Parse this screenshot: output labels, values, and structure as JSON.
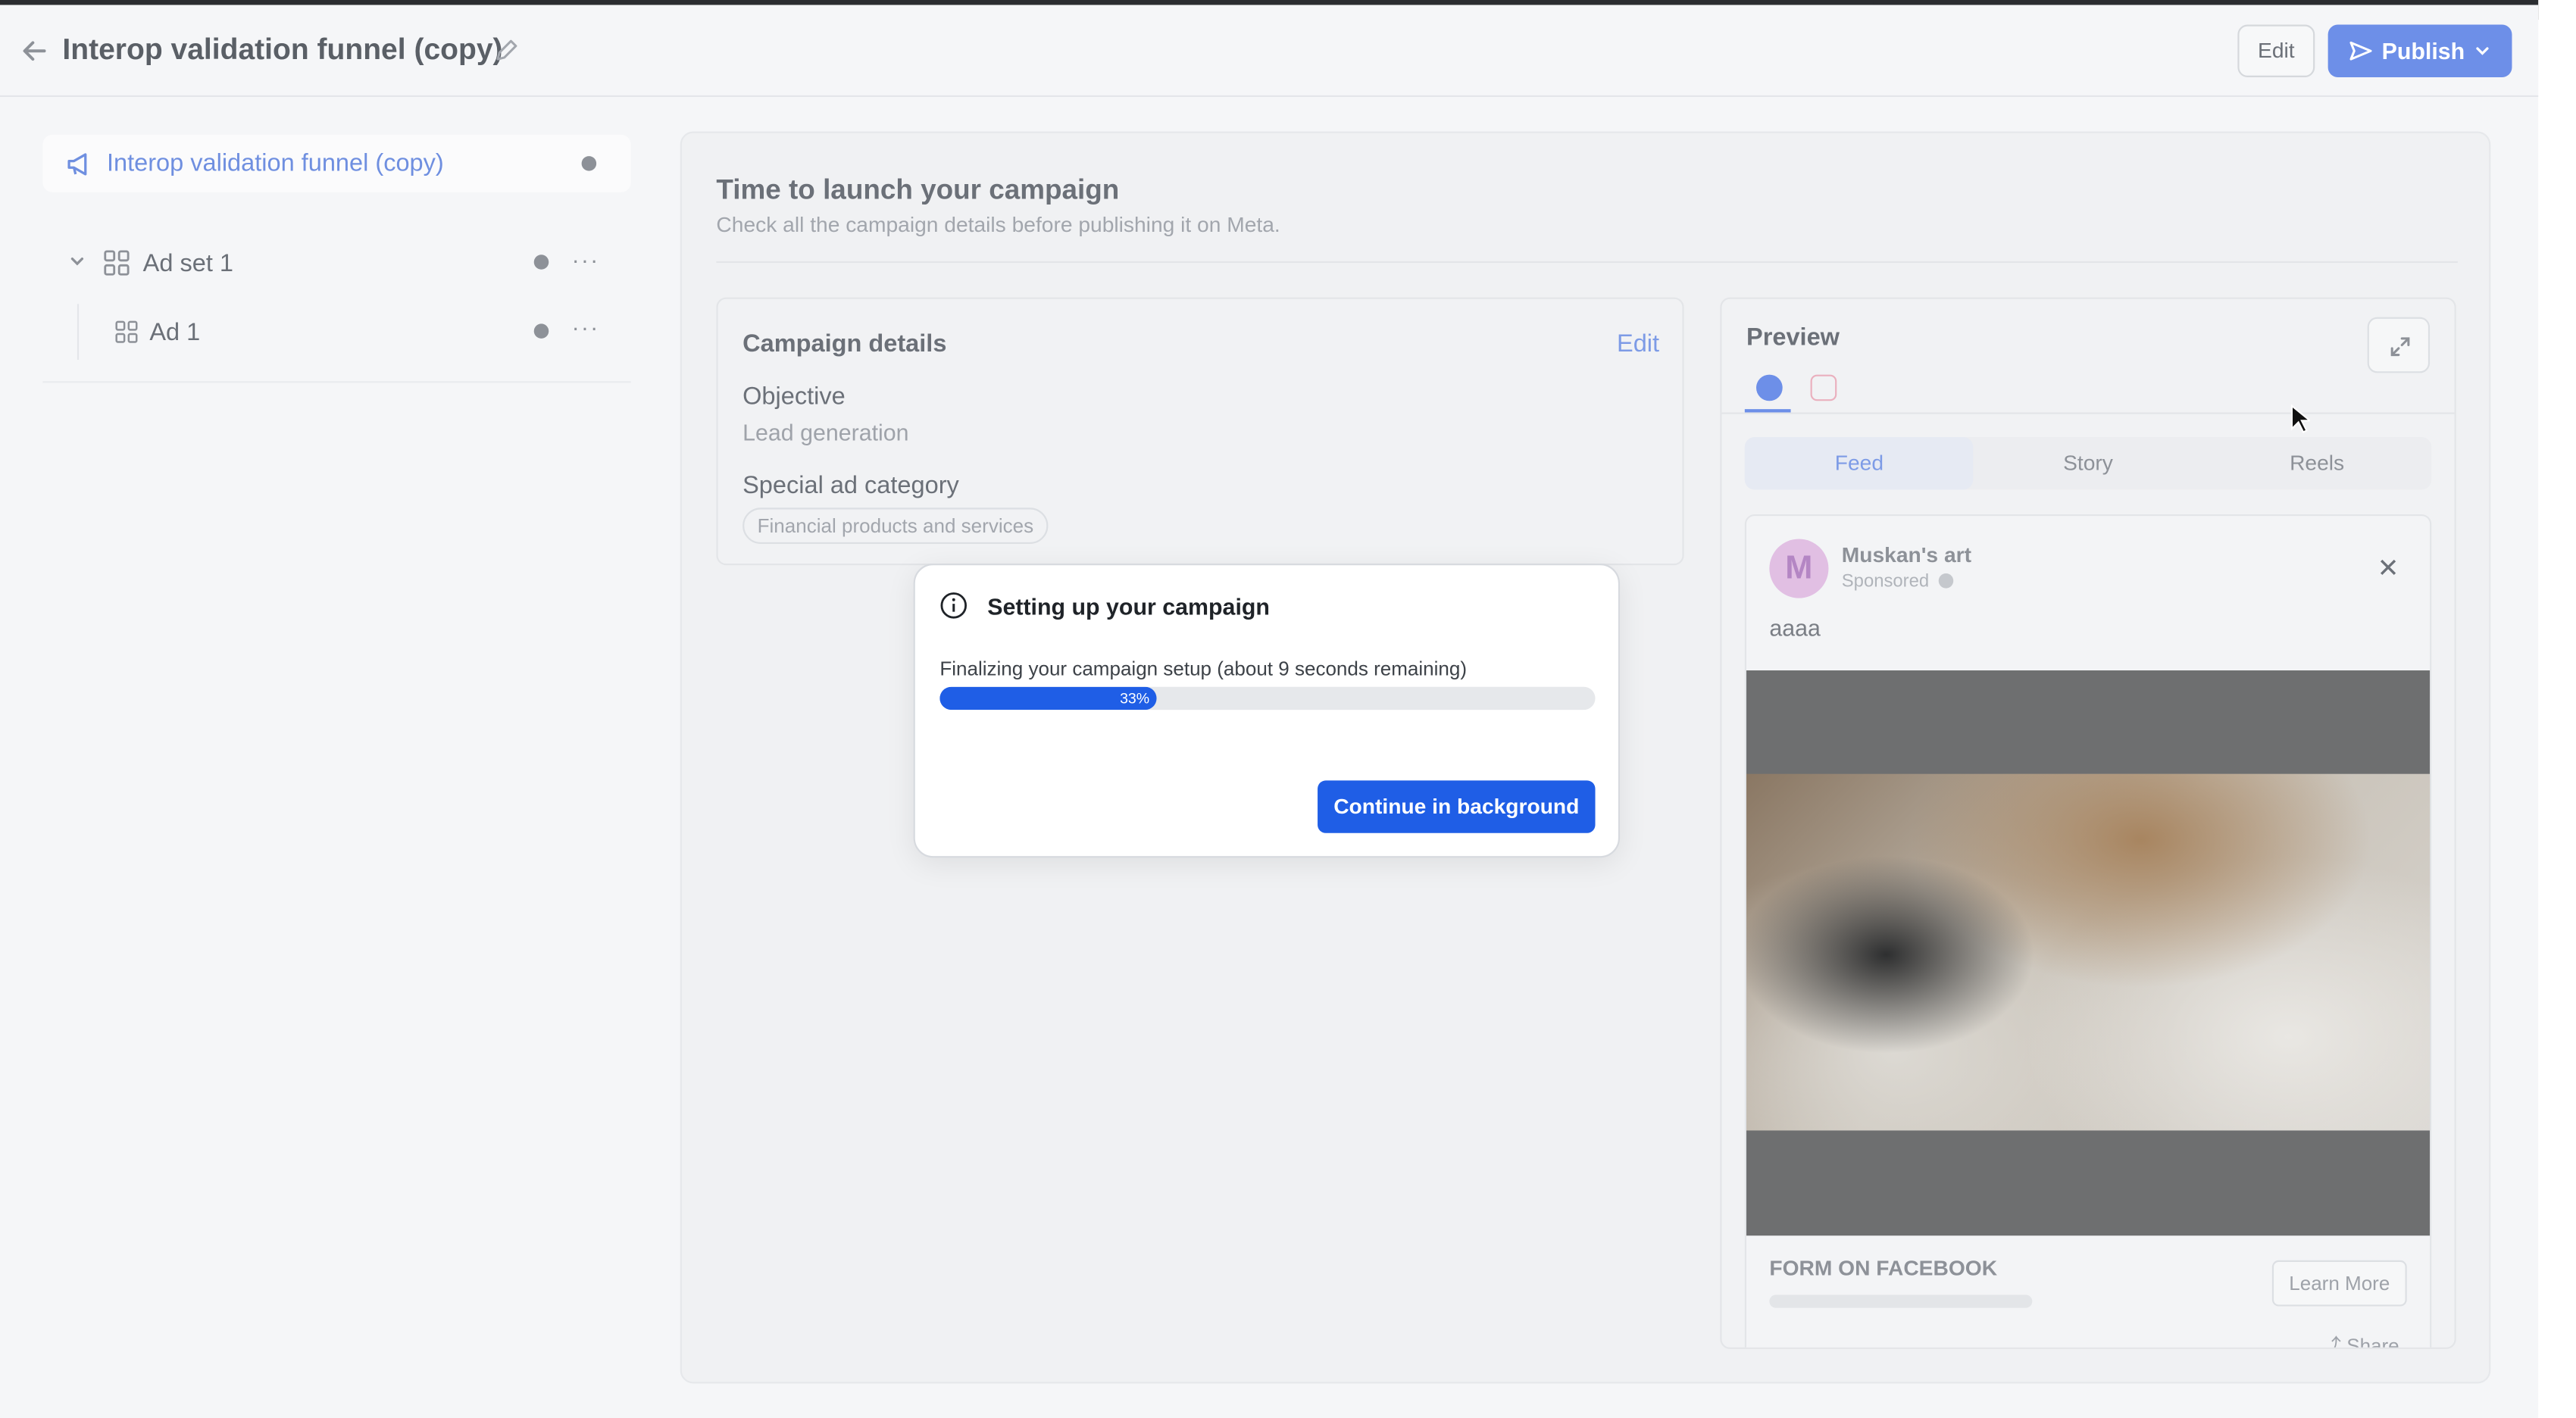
{
  "header": {
    "title": "Interop validation funnel (copy)",
    "edit_label": "Edit",
    "publish_label": "Publish"
  },
  "sidebar": {
    "campaign": {
      "label": "Interop validation funnel (copy)",
      "icon": "megaphone-icon"
    },
    "adset": {
      "label": "Ad set 1",
      "icon": "grid-icon"
    },
    "ad": {
      "label": "Ad 1",
      "icon": "grid-icon"
    },
    "more_label": "···"
  },
  "main": {
    "title": "Time to launch your campaign",
    "subtitle": "Check all the campaign details before publishing it on Meta.",
    "details": {
      "heading": "Campaign details",
      "edit_label": "Edit",
      "objective_label": "Objective",
      "objective_value": "Lead generation",
      "special_label": "Special ad category",
      "special_value": "Financial products and services"
    },
    "preview": {
      "heading": "Preview",
      "tabs": [
        "Feed",
        "Story",
        "Reels"
      ],
      "active_tab": "Feed",
      "ad": {
        "avatar_letter": "M",
        "page_name": "Muskan's art",
        "sponsored": "Sponsored",
        "body_text": "aaaa",
        "cta_caption": "FORM ON FACEBOOK",
        "cta_button": "Learn More",
        "share_label": "Share"
      }
    }
  },
  "modal": {
    "title": "Setting up your campaign",
    "message": "Finalizing your campaign setup (about 9 seconds remaining)",
    "progress_percent": 33,
    "progress_label": "33%",
    "button_label": "Continue in background"
  },
  "colors": {
    "accent": "#1f5ee6",
    "muted_accent": "#6d8fe8"
  }
}
